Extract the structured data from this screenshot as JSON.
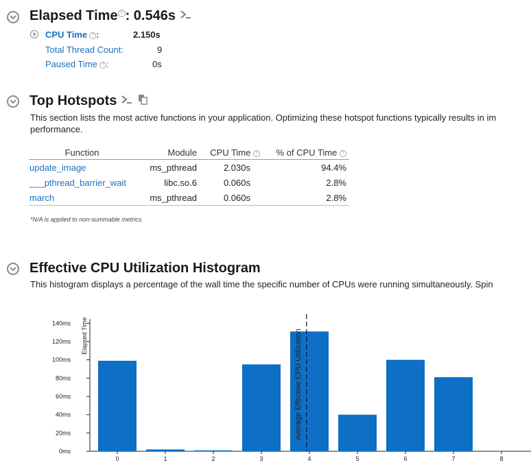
{
  "elapsed": {
    "title": "Elapsed Time",
    "value": ": 0.546s",
    "metrics": [
      {
        "label": "CPU Time",
        "value": "2.150s",
        "help": true,
        "colon": ":",
        "bold": true
      },
      {
        "label": "Total Thread Count:",
        "value": "9"
      },
      {
        "label": "Paused Time",
        "value": "0s",
        "help": true,
        "colon": ":"
      }
    ]
  },
  "hotspots": {
    "title": "Top Hotspots",
    "description_line1": "This section lists the most active functions in your application. Optimizing these hotspot functions typically results in im",
    "description_line2": "performance.",
    "columns": [
      "Function",
      "Module",
      "CPU Time",
      "% of CPU Time"
    ],
    "rows": [
      {
        "function": "update_image",
        "module": "ms_pthread",
        "cpu_time": "2.030s",
        "percent": "94.4%"
      },
      {
        "function": "___pthread_barrier_wait",
        "module": "libc.so.6",
        "cpu_time": "0.060s",
        "percent": "2.8%"
      },
      {
        "function": "march",
        "module": "ms_pthread",
        "cpu_time": "0.060s",
        "percent": "2.8%"
      }
    ],
    "note": "*N/A is applied to non-summable metrics."
  },
  "histogram": {
    "title": "Effective CPU Utilization Histogram",
    "description": "This histogram displays a percentage of the wall time the specific number of CPUs were running simultaneously. Spin"
  },
  "colors": {
    "bar": "#0d6fc6",
    "link": "#1a6fc0"
  },
  "chart_data": {
    "type": "bar",
    "categories": [
      "0",
      "1",
      "2",
      "3",
      "4",
      "5",
      "6",
      "7",
      "8"
    ],
    "values": [
      99,
      2,
      1,
      95,
      131,
      40,
      100,
      81,
      0
    ],
    "ylabel": "Elapsed Time",
    "ylim": [
      0,
      150
    ],
    "yticks": [
      0,
      20,
      40,
      60,
      80,
      100,
      120,
      140
    ],
    "ytick_labels": [
      "0ms",
      "20ms",
      "40ms",
      "60ms",
      "80ms",
      "100ms",
      "120ms",
      "140ms"
    ],
    "marker": {
      "label": "Average Effective CPU Utilization",
      "x": 3.94
    },
    "grid": false,
    "legend": "none"
  }
}
